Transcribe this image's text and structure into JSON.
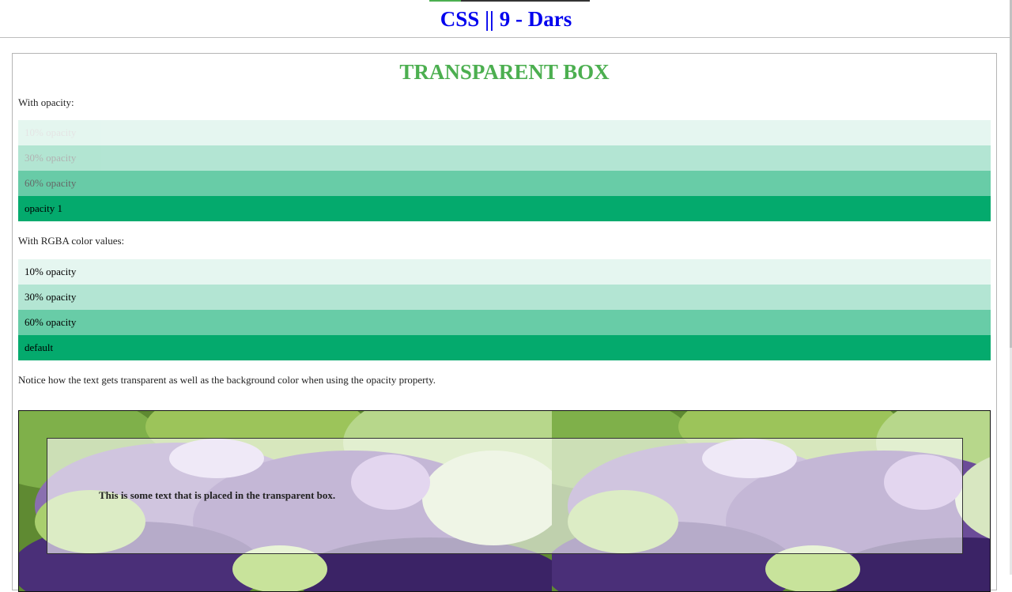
{
  "header": {
    "title": "CSS || 9 - Dars"
  },
  "card": {
    "title": "TRANSPARENT BOX",
    "opacity_label": "With opacity:",
    "opacity_rows": [
      {
        "label": "10% opacity",
        "opacity": 0.1
      },
      {
        "label": "30% opacity",
        "opacity": 0.3
      },
      {
        "label": "60% opacity",
        "opacity": 0.6
      },
      {
        "label": "opacity 1",
        "opacity": 1
      }
    ],
    "rgba_label": "With RGBA color values:",
    "rgba_rows": [
      {
        "label": "10% opacity",
        "alpha": 0.1
      },
      {
        "label": "30% opacity",
        "alpha": 0.3
      },
      {
        "label": "60% opacity",
        "alpha": 0.6
      },
      {
        "label": "default",
        "alpha": 1
      }
    ],
    "notice": "Notice how the text gets transparent as well as the background color when using the opacity property.",
    "transparent_box_text": "This is some text that is placed in the transparent box."
  },
  "colors": {
    "accent_green": "#04AA6D",
    "title_green": "#4CAF50",
    "link_blue": "#0000ee"
  }
}
